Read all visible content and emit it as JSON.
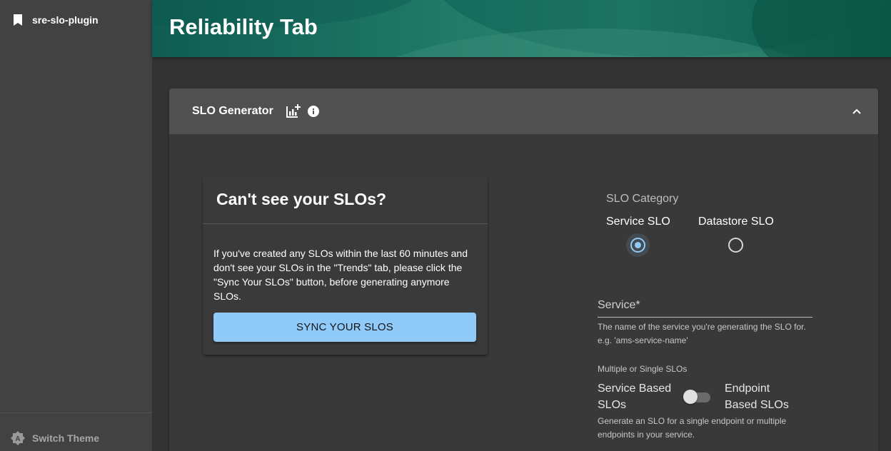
{
  "sidebar": {
    "plugin_label": "sre-slo-plugin",
    "switch_theme_label": "Switch Theme"
  },
  "header": {
    "title": "Reliability Tab"
  },
  "accordion": {
    "title": "SLO Generator"
  },
  "sync_card": {
    "title": "Can't see your SLOs?",
    "body": "If you've created any SLOs within the last 60 minutes and don't see your SLOs in the \"Trends\" tab, please click the \"Sync Your SLOs\" button, before generating anymore SLOs.",
    "button_label": "SYNC YOUR SLOS"
  },
  "form": {
    "slo_category": {
      "label": "SLO Category",
      "options": [
        "Service SLO",
        "Datastore SLO"
      ],
      "selected": "Service SLO"
    },
    "service": {
      "label": "Service*",
      "helper": "The name of the service you're generating the SLO for. e.g. 'ams-service-name'"
    },
    "slo_scope": {
      "label": "Multiple or Single SLOs",
      "left_option": "Service Based SLOs",
      "right_option": "Endpoint Based SLOs",
      "toggle_on": false,
      "helper": "Generate an SLO for a single endpoint or multiple endpoints in your service."
    }
  },
  "colors": {
    "accent": "#90caf9",
    "header_green": "#1f7a66",
    "sidebar_bg": "#424242",
    "page_bg": "#333333"
  }
}
